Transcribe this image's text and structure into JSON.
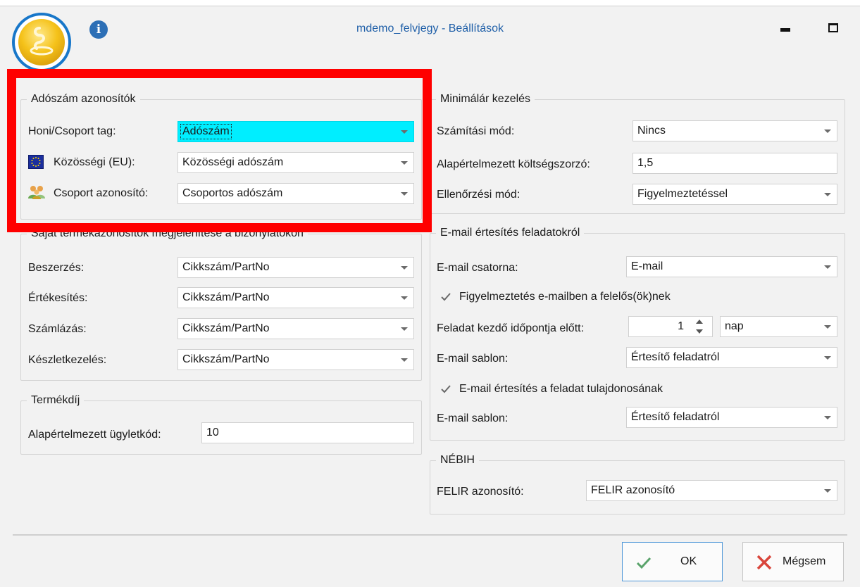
{
  "window": {
    "title": "mdemo_felvjegy - Beállítások",
    "icons": {
      "app": "app-logo-icon",
      "info": "info-icon",
      "minimize": "minimize-icon",
      "maximize": "maximize-icon"
    },
    "info_glyph": "i"
  },
  "accent_colors": {
    "title_text": "#1f5fa8",
    "highlight_field": "#00eeff",
    "callout_border": "#ff0000",
    "ok_border": "#4f97d8"
  },
  "tax_ids": {
    "legend": "Adószám azonosítók",
    "rows": [
      {
        "label": "Honi/Csoport tag:",
        "value": "Adószám",
        "icon": ""
      },
      {
        "label": "Közösségi (EU):",
        "value": "Közösségi adószám",
        "icon": "eu-flag-icon"
      },
      {
        "label": "Csoport azonosító:",
        "value": "Csoportos adószám",
        "icon": "people-group-icon"
      }
    ]
  },
  "own_product_ids": {
    "legend": "Saját termékazonosítók megjelenítése a bizonylatokon",
    "rows": [
      {
        "label": "Beszerzés:",
        "value": "Cikkszám/PartNo"
      },
      {
        "label": "Értékesítés:",
        "value": "Cikkszám/PartNo"
      },
      {
        "label": "Számlázás:",
        "value": "Cikkszám/PartNo"
      },
      {
        "label": "Készletkezelés:",
        "value": "Cikkszám/PartNo"
      }
    ]
  },
  "product_fee": {
    "legend": "Termékdíj",
    "label": "Alapértelmezett ügyletkód:",
    "value": "10"
  },
  "min_price": {
    "legend": "Minimálár kezelés",
    "calc_mode_label": "Számítási mód:",
    "calc_mode_value": "Nincs",
    "cost_multiplier_label": "Alapértelmezett költségszorzó:",
    "cost_multiplier_value": "1,5",
    "check_mode_label": "Ellenőrzési mód:",
    "check_mode_value": "Figyelmeztetéssel"
  },
  "email_tasks": {
    "legend": "E-mail értesítés feladatokról",
    "channel_label": "E-mail csatorna:",
    "channel_value": "E-mail",
    "notify_responsible_label": "Figyelmeztetés e-mailben a felelős(ök)nek",
    "notify_responsible_checked": true,
    "before_start_label": "Feladat kezdő időpontja előtt:",
    "before_start_value": "1",
    "before_start_unit": "nap",
    "template1_label": "E-mail sablon:",
    "template1_value": "Értesítő feladatról",
    "notify_owner_label": "E-mail értesítés a feladat tulajdonosának",
    "notify_owner_checked": true,
    "template2_label": "E-mail sablon:",
    "template2_value": "Értesítő feladatról"
  },
  "nebih": {
    "legend": "NÉBIH",
    "felir_label": "FELIR azonosító:",
    "felir_value": "FELIR azonosító"
  },
  "buttons": {
    "ok_label": "OK",
    "ok_icon": "checkmark-icon",
    "cancel_label": "Mégsem",
    "cancel_icon": "x-cross-icon"
  }
}
